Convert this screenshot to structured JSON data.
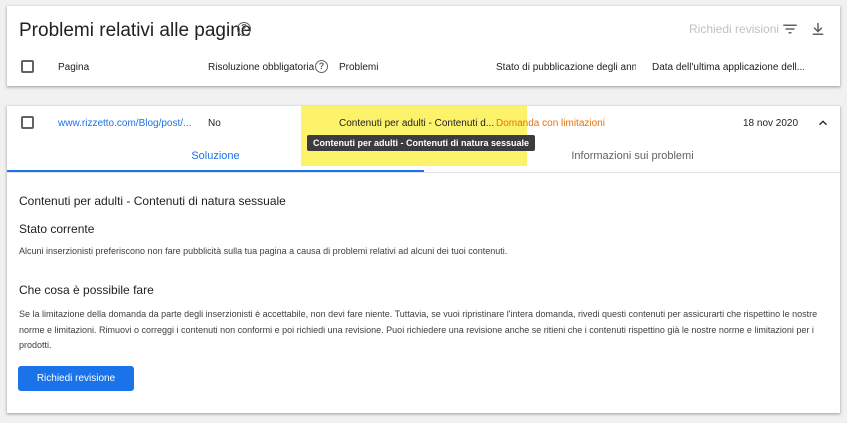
{
  "header": {
    "title": "Problemi relativi alle pagine",
    "request_review_label": "Richiedi revisioni",
    "icons": {
      "help": "help-circle-icon",
      "filter": "filter-icon",
      "download": "download-icon"
    },
    "columns": {
      "page": "Pagina",
      "resolution": "Risoluzione obbligatoria",
      "problems": "Problemi",
      "publication_state": "Stato di pubblicazione degli ann...",
      "last_applied": "Data dell'ultima applicazione dell..."
    }
  },
  "row": {
    "page_url": "www.rizzetto.com/Blog/post/...",
    "resolution": "No",
    "problems": "Contenuti per adulti - Contenuti d...",
    "state": "Domanda con limitazioni",
    "date": "18 nov 2020",
    "tooltip": "Contenuti per adulti - Contenuti di natura sessuale",
    "state_color": "#e8710a",
    "highlight_color": "#fdf36b"
  },
  "tabs": [
    {
      "label": "Soluzione"
    },
    {
      "label": "Informazioni sui problemi"
    }
  ],
  "detail": {
    "section_title": "Contenuti per adulti - Contenuti di natura sessuale",
    "current_state_title": "Stato corrente",
    "current_state_text": "Alcuni inserzionisti preferiscono non fare pubblicità sulla tua pagina a causa di problemi relativi ad alcuni dei tuoi contenuti.",
    "what_to_do_title": "Che cosa è possibile fare",
    "what_to_do_text": "Se la limitazione della domanda da parte degli inserzionisti è accettabile, non devi fare niente. Tuttavia, se vuoi ripristinare l'intera domanda, rivedi questi contenuti per assicurarti che rispettino le nostre norme e limitazioni. Rimuovi o correggi i contenuti non conformi e poi richiedi una revisione. Puoi richiedere una revisione anche se ritieni che i contenuti rispettino già le nostre norme e limitazioni per i prodotti.",
    "review_button_label": "Richiedi revisione"
  },
  "colors": {
    "accent": "#1a73e8",
    "warning": "#e8710a"
  }
}
